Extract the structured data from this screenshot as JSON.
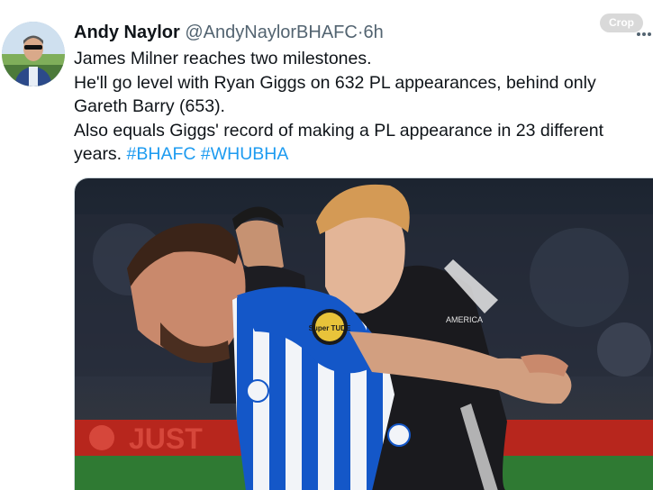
{
  "crop_label": "Crop",
  "tweet": {
    "author_name": "Andy Naylor",
    "author_handle": "@AndyNaylorBHAFC",
    "separator": "·",
    "time": "6h",
    "lines": [
      "James Milner reaches two milestones.",
      "He'll go level with Ryan Giggs on 632 PL appearances, behind only",
      "Gareth Barry (653).",
      "Also equals Giggs' record of making a PL appearance in 23 different",
      "years."
    ],
    "hashtags": [
      "#BHAFC",
      "#WHUBHA"
    ],
    "media": {
      "sleeve_patch": "Super TUDE",
      "board_text": "JUST",
      "sponsor_text": "AMERICA"
    }
  },
  "colors": {
    "hashtag": "#1d9bf0",
    "brighton_blue": "#0b57c9",
    "ajax_dark": "#1a1a1e",
    "board_red": "#b7261d"
  },
  "icons": {
    "more": "ellipsis-icon"
  }
}
